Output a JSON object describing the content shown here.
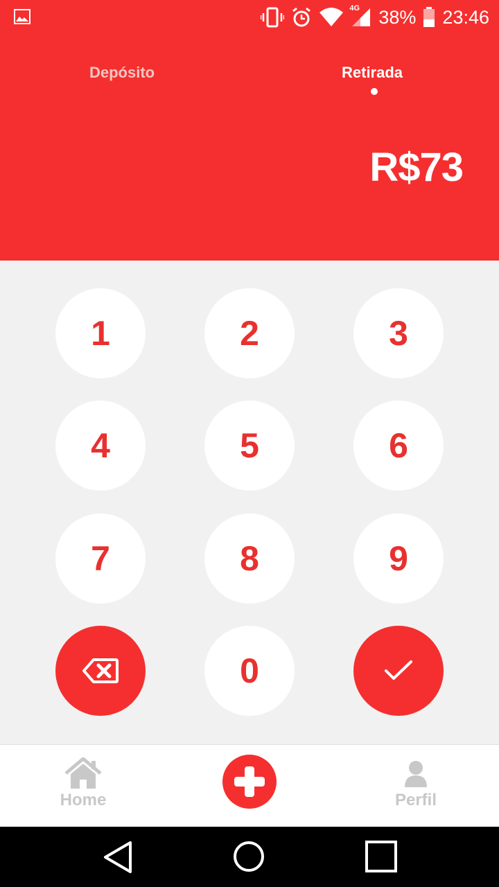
{
  "status_bar": {
    "battery": "38%",
    "time": "23:46",
    "network": "4G",
    "icons": [
      "gallery-icon",
      "vibrate-icon",
      "alarm-icon",
      "wifi-icon",
      "signal-icon",
      "battery-icon"
    ]
  },
  "header": {
    "tabs": [
      {
        "label": "Depósito",
        "active": false
      },
      {
        "label": "Retirada",
        "active": true
      }
    ],
    "amount": "R$73"
  },
  "keypad": {
    "keys": [
      "1",
      "2",
      "3",
      "4",
      "5",
      "6",
      "7",
      "8",
      "9",
      "0"
    ],
    "backspace_icon": "backspace-icon",
    "confirm_icon": "check-icon"
  },
  "bottom_nav": {
    "home_label": "Home",
    "perfil_label": "Perfil",
    "add_icon": "plus-icon"
  },
  "colors": {
    "primary": "#f52f2f",
    "keypad_bg": "#f1f1f1",
    "key_text": "#e8312f",
    "inactive_tab": "#f3c6c2",
    "nav_inactive": "#c8c8c8"
  }
}
